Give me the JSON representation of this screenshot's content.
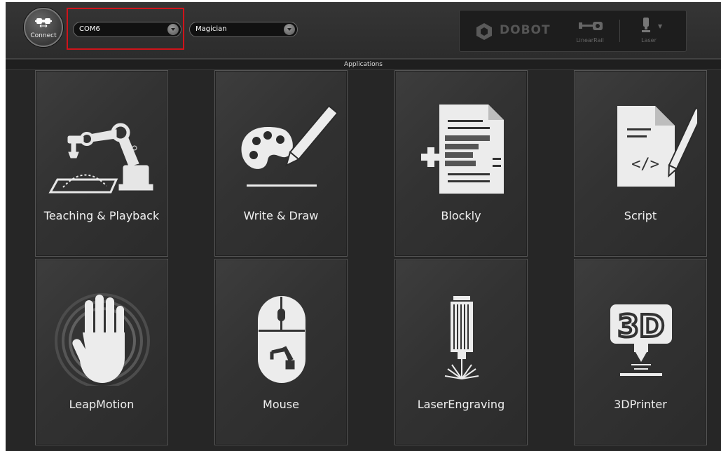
{
  "toolbar": {
    "connect_label": "Connect",
    "port_value": "COM6",
    "device_value": "Magician"
  },
  "brand": {
    "name": "DOBOT",
    "addon_rail_label": "LinearRail",
    "addon_laser_label": "Laser"
  },
  "section": {
    "title": "Applications"
  },
  "apps": [
    {
      "label": "Teaching & Playback",
      "icon": "robot-arm-icon"
    },
    {
      "label": "Write & Draw",
      "icon": "palette-pencil-icon"
    },
    {
      "label": "Blockly",
      "icon": "blockly-document-icon"
    },
    {
      "label": "Script",
      "icon": "script-document-icon"
    },
    {
      "label": "LeapMotion",
      "icon": "hand-icon"
    },
    {
      "label": "Mouse",
      "icon": "mouse-icon"
    },
    {
      "label": "LaserEngraving",
      "icon": "laser-icon"
    },
    {
      "label": "3DPrinter",
      "icon": "3d-printer-icon"
    }
  ],
  "colors": {
    "highlight": "#d0131a",
    "background": "#262626",
    "tile": "#353535"
  }
}
